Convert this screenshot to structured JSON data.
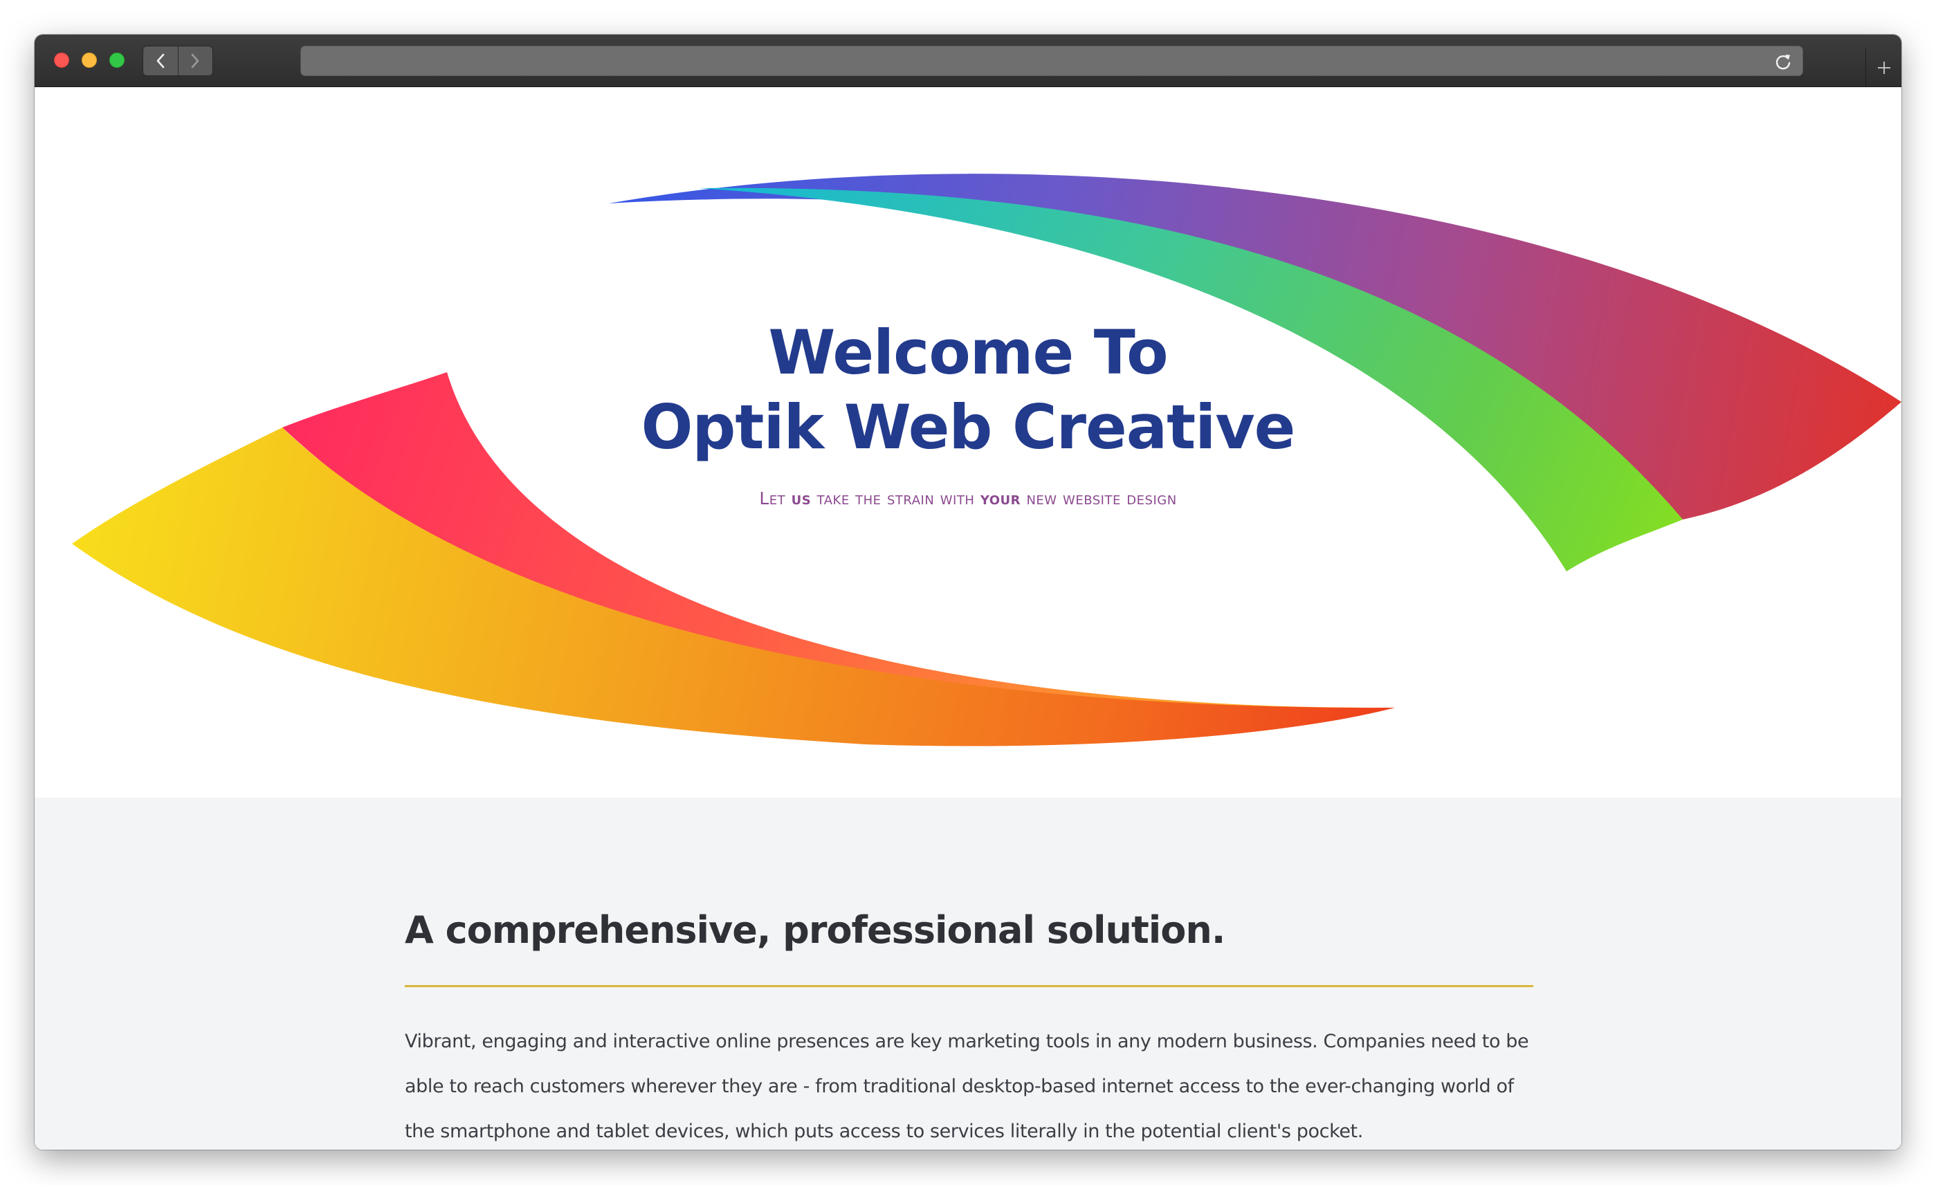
{
  "browser": {
    "controls": [
      "close",
      "minimize",
      "zoom"
    ],
    "nav_icons": [
      "back-chevron-icon",
      "forward-chevron-icon"
    ],
    "address_bar_icon": "reload-icon",
    "new_tab_icon": "plus-icon"
  },
  "hero": {
    "title_line1": "Welcome To",
    "title_line2": "Optik Web Creative",
    "tagline_parts": {
      "part1": "Let ",
      "em1": "us",
      "part2": " take the strain with ",
      "em2": "your",
      "part3": " new website design"
    }
  },
  "section": {
    "heading": "A comprehensive, professional solution.",
    "body": "Vibrant, engaging and interactive online presences are key marketing tools in any modern business. Companies need to be able to reach customers wherever they are - from traditional desktop-based internet access to the ever-changing world of the smartphone and tablet devices, which puts access to services literally in the potential client's pocket."
  },
  "colors": {
    "title": "#233b8d",
    "tagline": "#8b4a8f",
    "heading_rule": "#d9b53b",
    "content_bg": "#f3f4f5"
  }
}
